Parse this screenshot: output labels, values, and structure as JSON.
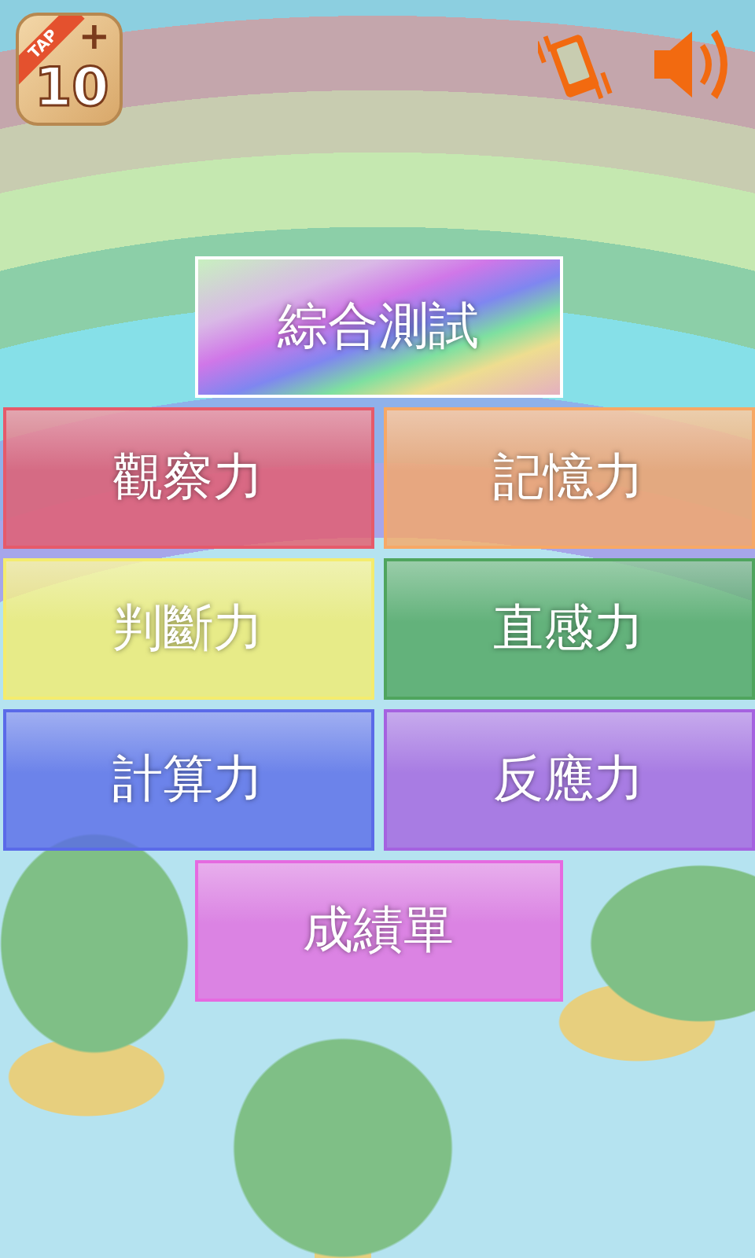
{
  "logo": {
    "ribbon": "TAP",
    "number": "10",
    "plus": "+"
  },
  "toolbar": {
    "vibration_on": true,
    "sound_on": true
  },
  "featured": {
    "label": "綜合測試",
    "kind": "rainbow"
  },
  "modes": [
    {
      "label": "觀察力",
      "color": "#e65a6a"
    },
    {
      "label": "記憶力",
      "color": "#f7a865"
    },
    {
      "label": "判斷力",
      "color": "#f4ec6e"
    },
    {
      "label": "直感力",
      "color": "#4fa55e"
    },
    {
      "label": "計算力",
      "color": "#5a6ae8"
    },
    {
      "label": "反應力",
      "color": "#a562e0"
    }
  ],
  "results": {
    "label": "成績單",
    "color": "#e56ae0"
  }
}
